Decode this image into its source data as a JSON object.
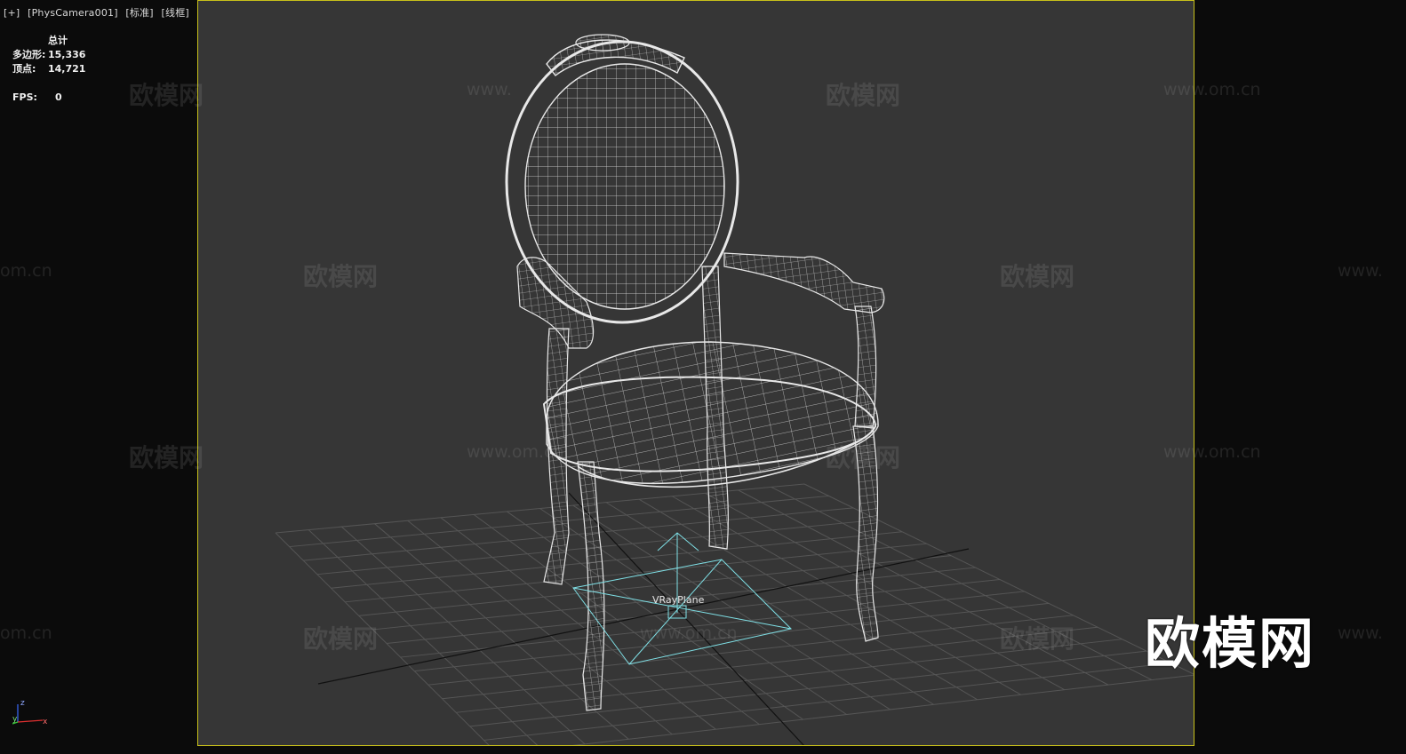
{
  "viewport": {
    "labels": [
      "[+]",
      "[PhysCamera001]",
      "[标准]",
      "[线框]"
    ]
  },
  "stats": {
    "header": "总计",
    "polygons_label": "多边形:",
    "polygons_value": "15,336",
    "vertices_label": "顶点:",
    "vertices_value": "14,721",
    "fps_label": "FPS:",
    "fps_value": "0"
  },
  "scene": {
    "object_label": "VRayPlane",
    "frame_color": "#c8c11a",
    "wire_color": "#e8e8e8",
    "helper_color": "#7fe0e6"
  },
  "watermarks": {
    "brand": "欧模网",
    "url": "www.om.cn",
    "url_partial_left": "om.cn",
    "url_partial_right": "www.",
    "url_partial_mid": "www."
  },
  "logo": {
    "text": "欧模网"
  },
  "axis": {
    "x": "x",
    "y": "y",
    "z": "z"
  }
}
